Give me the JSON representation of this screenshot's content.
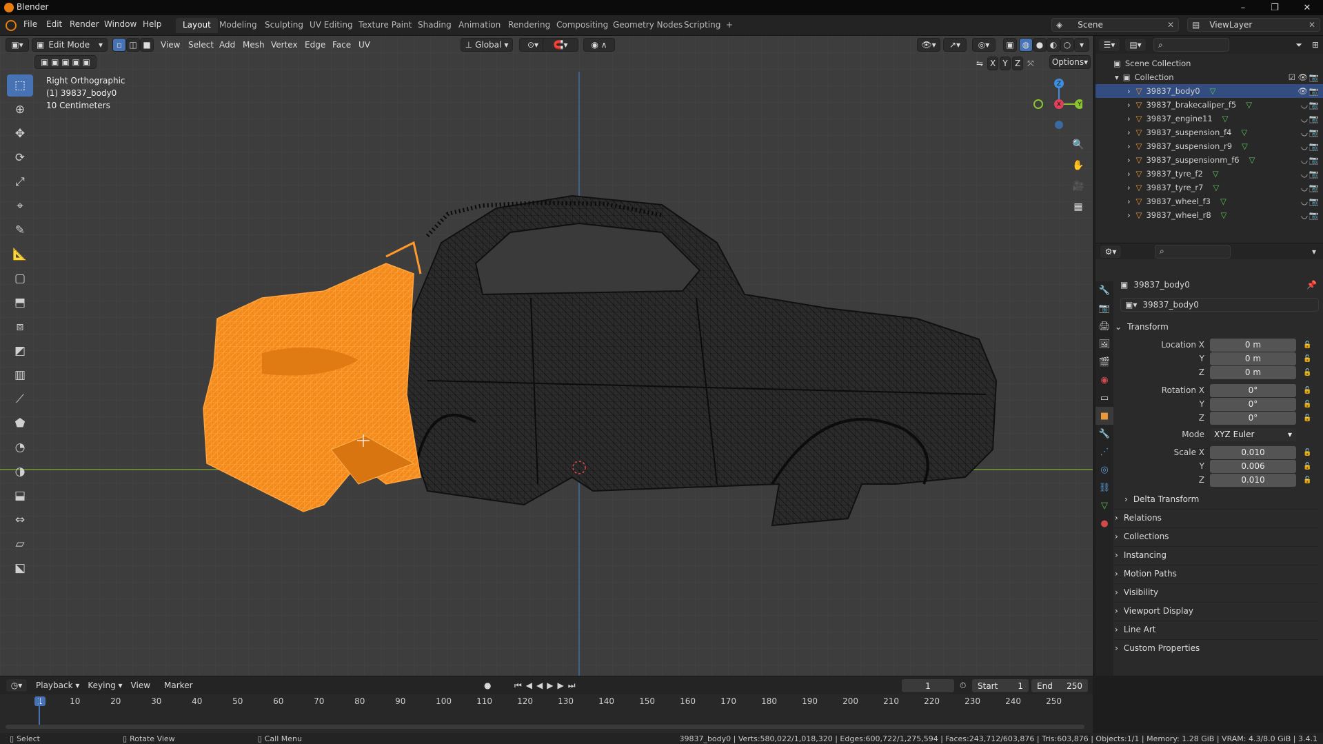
{
  "window": {
    "title": "Blender",
    "controls": [
      "–",
      "❐",
      "✕"
    ]
  },
  "menubar": [
    "File",
    "Edit",
    "Render",
    "Window",
    "Help"
  ],
  "workspaces": [
    "Layout",
    "Modeling",
    "Sculpting",
    "UV Editing",
    "Texture Paint",
    "Shading",
    "Animation",
    "Rendering",
    "Compositing",
    "Geometry Nodes",
    "Scripting",
    "+"
  ],
  "active_workspace": "Layout",
  "scene": {
    "label": "Scene",
    "view_layer": "ViewLayer"
  },
  "viewport_header": {
    "mode": "Edit Mode",
    "menus": [
      "View",
      "Select",
      "Add",
      "Mesh",
      "Vertex",
      "Edge",
      "Face",
      "UV"
    ],
    "orientation": "Global",
    "options_label": "Options",
    "axis_labels": [
      "X",
      "Y",
      "Z"
    ]
  },
  "viewport_info": [
    "Right Orthographic",
    "(1) 39837_body0",
    "10 Centimeters"
  ],
  "gizmo_axes": {
    "x_color": "#e0405a",
    "y_color": "#8ac531",
    "z_color": "#3b8ee0"
  },
  "outliner": {
    "root": "Scene Collection",
    "collection": "Collection",
    "objects": [
      "39837_body0",
      "39837_brakecaliper_f5",
      "39837_engine11",
      "39837_suspension_f4",
      "39837_suspension_r9",
      "39837_suspensionm_f6",
      "39837_tyre_f2",
      "39837_tyre_r7",
      "39837_wheel_f3",
      "39837_wheel_r8"
    ]
  },
  "properties": {
    "object_name": "39837_body0",
    "data_name": "39837_body0",
    "transform_label": "Transform",
    "location": {
      "label": "Location X",
      "x": "0 m",
      "y": "0 m",
      "z": "0 m"
    },
    "rotation": {
      "label": "Rotation X",
      "x": "0°",
      "y": "0°",
      "z": "0°"
    },
    "mode_label": "Mode",
    "mode_value": "XYZ Euler",
    "scale": {
      "label": "Scale X",
      "x": "0.010",
      "y": "0.006",
      "z": "0.010"
    },
    "axis_y": "Y",
    "axis_z": "Z",
    "delta": "Delta Transform",
    "panels": [
      "Relations",
      "Collections",
      "Instancing",
      "Motion Paths",
      "Visibility",
      "Viewport Display",
      "Line Art",
      "Custom Properties"
    ]
  },
  "timeline": {
    "menus": [
      "Playback",
      "Keying",
      "View",
      "Marker"
    ],
    "current_frame": "1",
    "start_label": "Start",
    "start": "1",
    "end_label": "End",
    "end": "250",
    "ticks": [
      "1",
      "10",
      "20",
      "30",
      "40",
      "50",
      "60",
      "70",
      "80",
      "90",
      "100",
      "110",
      "120",
      "130",
      "140",
      "150",
      "160",
      "170",
      "180",
      "190",
      "200",
      "210",
      "220",
      "230",
      "240",
      "250"
    ]
  },
  "statusbar": {
    "left": [
      "Select",
      "Rotate View",
      "Call Menu"
    ],
    "right": "39837_body0 | Verts:580,022/1,018,320 | Edges:600,722/1,275,594 | Faces:243,712/603,876 | Tris:603,876 | Objects:1/1 | Memory: 1.28 GiB | VRAM: 4.3/8.0 GiB | 3.4.1"
  },
  "colors": {
    "accent": "#4772b3",
    "selection_orange": "#ff8c1a",
    "viewport_bg": "#3d3d3d",
    "x_axis_line": "#7b9b34",
    "z_axis_line": "#3c6ea8"
  }
}
